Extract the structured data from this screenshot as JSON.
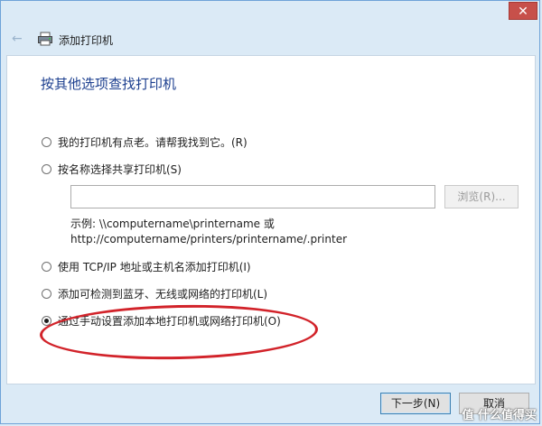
{
  "window": {
    "close_label": "✕"
  },
  "nav": {
    "back_icon": "back-arrow-icon",
    "title": "添加打印机"
  },
  "content": {
    "heading": "按其他选项查找打印机",
    "options": [
      {
        "label": "我的打印机有点老。请帮我找到它。(R)",
        "checked": false
      },
      {
        "label": "按名称选择共享打印机(S)",
        "checked": false
      },
      {
        "label": "使用 TCP/IP 地址或主机名添加打印机(I)",
        "checked": false
      },
      {
        "label": "添加可检测到蓝牙、无线或网络的打印机(L)",
        "checked": false
      },
      {
        "label": "通过手动设置添加本地打印机或网络打印机(O)",
        "checked": true
      }
    ],
    "share_input": {
      "value": ""
    },
    "browse_label": "浏览(R)...",
    "example_line1": "示例: \\\\computername\\printername 或",
    "example_line2": "http://computername/printers/printername/.printer"
  },
  "footer": {
    "next_label": "下一步(N)",
    "cancel_label": "取消"
  },
  "watermark": "值 什么值得买",
  "colors": {
    "heading": "#1c3f8f",
    "highlight": "#d2232a",
    "close": "#c7504a"
  }
}
